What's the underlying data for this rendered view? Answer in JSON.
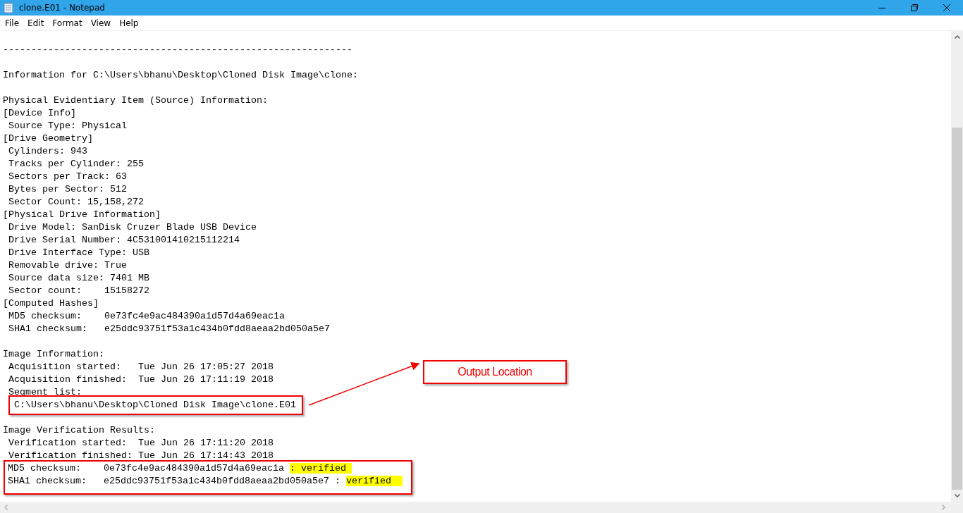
{
  "window": {
    "title": "clone.E01 - Notepad"
  },
  "menu": [
    "File",
    "Edit",
    "Format",
    "View",
    "Help"
  ],
  "lines": [
    {
      "kind": "blank"
    },
    {
      "kind": "text",
      "text": "--------------------------------------------------------------"
    },
    {
      "kind": "blank"
    },
    {
      "kind": "text",
      "text": "Information for C:\\Users\\bhanu\\Desktop\\Cloned Disk Image\\clone:"
    },
    {
      "kind": "blank"
    },
    {
      "kind": "text",
      "text": "Physical Evidentiary Item (Source) Information:"
    },
    {
      "kind": "text",
      "text": "[Device Info]"
    },
    {
      "kind": "text",
      "text": " Source Type: Physical"
    },
    {
      "kind": "text",
      "text": "[Drive Geometry]"
    },
    {
      "kind": "text",
      "text": " Cylinders: 943"
    },
    {
      "kind": "text",
      "text": " Tracks per Cylinder: 255"
    },
    {
      "kind": "text",
      "text": " Sectors per Track: 63"
    },
    {
      "kind": "text",
      "text": " Bytes per Sector: 512"
    },
    {
      "kind": "text",
      "text": " Sector Count: 15,158,272"
    },
    {
      "kind": "text",
      "text": "[Physical Drive Information]"
    },
    {
      "kind": "text",
      "text": " Drive Model: SanDisk Cruzer Blade USB Device"
    },
    {
      "kind": "text",
      "text": " Drive Serial Number: 4C531001410215112214"
    },
    {
      "kind": "text",
      "text": " Drive Interface Type: USB"
    },
    {
      "kind": "text",
      "text": " Removable drive: True"
    },
    {
      "kind": "text",
      "text": " Source data size: 7401 MB"
    },
    {
      "kind": "text",
      "text": " Sector count:    15158272"
    },
    {
      "kind": "text",
      "text": "[Computed Hashes]"
    },
    {
      "kind": "text",
      "text": " MD5 checksum:    0e73fc4e9ac484390a1d57d4a69eac1a"
    },
    {
      "kind": "text",
      "text": " SHA1 checksum:   e25ddc93751f53a1c434b0fdd8aeaa2bd050a5e7"
    },
    {
      "kind": "blank"
    },
    {
      "kind": "text",
      "text": "Image Information:"
    },
    {
      "kind": "text",
      "text": " Acquisition started:   Tue Jun 26 17:05:27 2018"
    },
    {
      "kind": "text",
      "text": " Acquisition finished:  Tue Jun 26 17:11:19 2018"
    },
    {
      "kind": "text",
      "text": " Segment list:"
    },
    {
      "kind": "path-box",
      "lines": [
        {
          "text": "C:\\Users\\bhanu\\Desktop\\Cloned Disk Image\\clone.E01"
        }
      ]
    },
    {
      "kind": "blank"
    },
    {
      "kind": "text",
      "text": "Image Verification Results:"
    },
    {
      "kind": "text",
      "text": " Verification started:  Tue Jun 26 17:11:20 2018"
    },
    {
      "kind": "text",
      "text": " Verification finished: Tue Jun 26 17:14:43 2018"
    },
    {
      "kind": "hash-box",
      "lines": [
        {
          "text": "MD5 checksum:    0e73fc4e9ac484390a1d57d4a69eac1a ",
          "highlight": ": verified "
        },
        {
          "text": "SHA1 checksum:   e25ddc93751f53a1c434b0fdd8aeaa2bd050a5e7 : ",
          "highlight": "verified  "
        }
      ]
    }
  ],
  "callout": {
    "text": "Output Location"
  }
}
